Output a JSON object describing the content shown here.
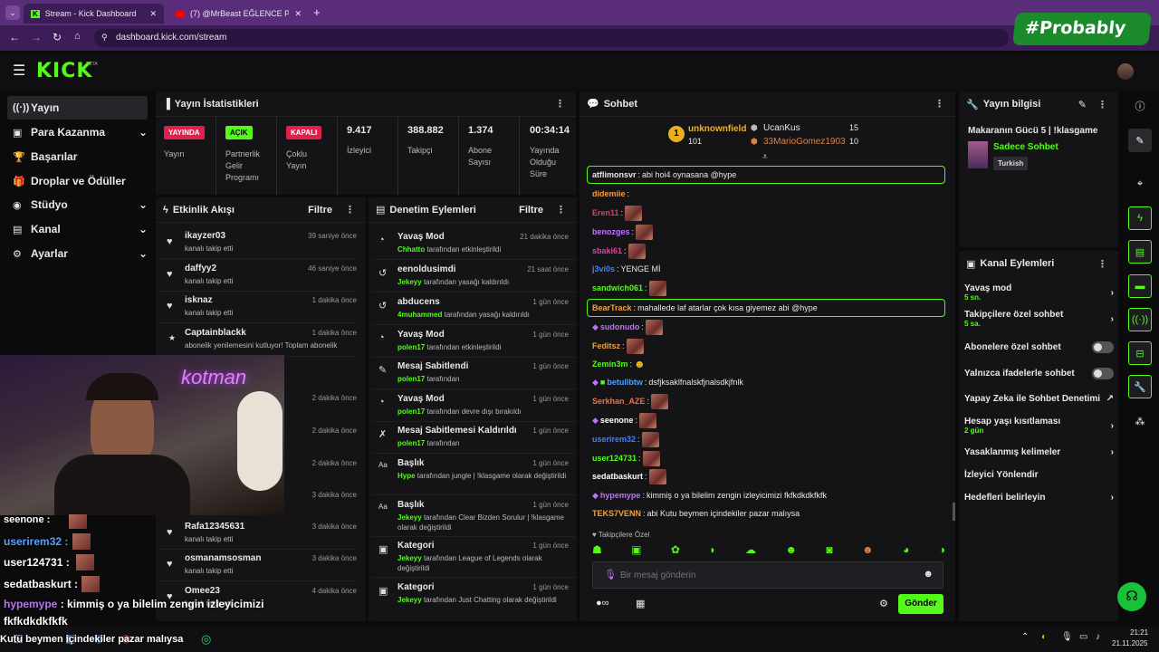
{
  "browser": {
    "tab1": "Stream - Kick Dashboard",
    "tab2": "(7) @MrBeast EĞLENCE PARKI...",
    "url": "dashboard.kick.com/stream"
  },
  "watermark": "#Probably",
  "app": {
    "logo": "KICK",
    "beta": "BETA"
  },
  "nav": [
    {
      "icon": "((·))",
      "label": "Yayın"
    },
    {
      "icon": "▣",
      "label": "Para Kazanma"
    },
    {
      "icon": "🏆",
      "label": "Başarılar"
    },
    {
      "icon": "🎁",
      "label": "Droplar ve Ödüller"
    },
    {
      "icon": "◉",
      "label": "Stüdyo"
    },
    {
      "icon": "▤",
      "label": "Kanal"
    },
    {
      "icon": "⚙",
      "label": "Ayarlar"
    }
  ],
  "stats": {
    "title": "Yayın İstatistikleri",
    "b1": "YAYINDA",
    "l1": "Yayın",
    "b2": "AÇIK",
    "l2a": "Partnerlik",
    "l2b": "Gelir",
    "l2c": "Programı",
    "b3": "KAPALI",
    "l3a": "Çoklu",
    "l3b": "Yayın",
    "v4": "9.417",
    "l4": "İzleyici",
    "v5": "388.882",
    "l5": "Takipçi",
    "v6": "1.374",
    "l6a": "Abone",
    "l6b": "Sayısı",
    "v7": "00:34:14",
    "l7a": "Yayında",
    "l7b": "Olduğu",
    "l7c": "Süre"
  },
  "activity": {
    "title": "Etkinlik Akışı",
    "filter": "Filtre",
    "items": [
      {
        "name": "ikayzer03",
        "sub": "kanalı takip etti",
        "time": "39 saniye önce"
      },
      {
        "name": "daffyy2",
        "sub": "kanalı takip etti",
        "time": "46 saniye önce"
      },
      {
        "name": "isknaz",
        "sub": "kanalı takip etti",
        "time": "1 dakika önce"
      },
      {
        "name": "Captainblackk",
        "sub": "abonelik yenilemesini kutluyor! Toplam abonelik",
        "time": "1 dakika önce"
      },
      {
        "name": "",
        "sub": "",
        "time": "2 dakika önce"
      },
      {
        "name": "",
        "sub": "",
        "time": "2 dakika önce"
      },
      {
        "name": "",
        "sub": "",
        "time": "2 dakika önce"
      },
      {
        "name": "",
        "sub": "",
        "time": "3 dakika önce"
      },
      {
        "name": "Rafa12345631",
        "sub": "kanalı takip etti",
        "time": "3 dakika önce"
      },
      {
        "name": "osmanamsosman",
        "sub": "kanalı takip etti",
        "time": "3 dakika önce"
      },
      {
        "name": "Omee23",
        "sub": "kanalı takip etti",
        "time": "4 dakika önce"
      }
    ]
  },
  "moderation": {
    "title": "Denetim Eylemleri",
    "filter": "Filtre",
    "items": [
      {
        "icon": "◔",
        "name": "Yavaş Mod",
        "who": "Chhatto",
        "rest": "tarafından etkinleştirildi",
        "time": "21 dakika önce"
      },
      {
        "icon": "↺",
        "name": "eenoldusimdi",
        "who": "Jekeyy",
        "rest": "tarafından yasağı kaldırıldı",
        "time": "21 saat önce"
      },
      {
        "icon": "↺",
        "name": "abducens",
        "who": "4muhammed",
        "rest": "tarafından yasağı kaldırıldı",
        "time": "1 gün önce"
      },
      {
        "icon": "◔",
        "name": "Yavaş Mod",
        "who": "polen17",
        "rest": "tarafından etkinleştirildi",
        "time": "1 gün önce"
      },
      {
        "icon": "✎",
        "name": "Mesaj Sabitlendi",
        "who": "polen17",
        "rest": "tarafından",
        "time": "1 gün önce"
      },
      {
        "icon": "◔",
        "name": "Yavaş Mod",
        "who": "polen17",
        "rest": "tarafından devre dışı bırakıldı",
        "time": "1 gün önce"
      },
      {
        "icon": "✗",
        "name": "Mesaj Sabitlemesi Kaldırıldı",
        "who": "polen17",
        "rest": "tarafından",
        "time": "1 gün önce"
      },
      {
        "icon": "Aa",
        "name": "Başlık",
        "who": "Hype",
        "rest": "tarafından jungle | !klasgame olarak değiştirildi",
        "time": "1 gün önce"
      },
      {
        "icon": "Aa",
        "name": "Başlık",
        "who": "Jekeyy",
        "rest": "tarafından Clear Bizden Sorulur | !klasgame olarak değiştirildi",
        "time": "1 gün önce"
      },
      {
        "icon": "▣",
        "name": "Kategori",
        "who": "Jekeyy",
        "rest": "tarafından League of Legends olarak değiştirildi",
        "time": "1 gün önce"
      },
      {
        "icon": "▣",
        "name": "Kategori",
        "who": "Jekeyy",
        "rest": "tarafından Just Chatting olarak değiştirildi",
        "time": "1 gün önce"
      }
    ]
  },
  "chat": {
    "title": "Sohbet",
    "top1": {
      "name": "unknownfield",
      "count": "101"
    },
    "top2": {
      "name": "UcanKus",
      "count": "15"
    },
    "top3": {
      "name": "33MarioGomez1903",
      "count": "10"
    },
    "messages": [
      {
        "user": "atflimonsvr",
        "color": "#fff",
        "text": "abi hoi4 oynasana @hype",
        "pinned": true
      },
      {
        "user": "didemiie",
        "color": "#f0a040",
        "text": ""
      },
      {
        "user": "Eren11",
        "color": "#e0405a",
        "text": ""
      },
      {
        "user": "benozges",
        "color": "#c070ff",
        "text": ""
      },
      {
        "user": "sbaki61",
        "color": "#e040a0",
        "text": ""
      },
      {
        "user": "j3vi0s",
        "color": "#4080ff",
        "text": "YENGE Mİ"
      },
      {
        "user": "sandwich061",
        "color": "#53fc18",
        "text": ""
      },
      {
        "user": "BearTrack",
        "color": "#f0a040",
        "text": "mahallede laf atarlar çok kısa giyemez abi @hype",
        "pinned": true
      },
      {
        "user": "sudonudo",
        "color": "#c070ff",
        "text": ""
      },
      {
        "user": "Feditsz",
        "color": "#f0a040",
        "text": ""
      },
      {
        "user": "Zemin3m",
        "color": "#53fc18",
        "text": ""
      },
      {
        "user": "betullbtw",
        "color": "#4aa0ff",
        "text": "dsfjksaklfnalskfjnalsdkjfnlk"
      },
      {
        "user": "Serkhan_AZE",
        "color": "#f07040",
        "text": ""
      },
      {
        "user": "seenone",
        "color": "#fff",
        "text": ""
      },
      {
        "user": "userirem32",
        "color": "#4080ff",
        "text": ""
      },
      {
        "user": "user124731",
        "color": "#53fc18",
        "text": ""
      },
      {
        "user": "sedatbaskurt",
        "color": "#fff",
        "text": ""
      },
      {
        "user": "hypemype",
        "color": "#c070ff",
        "text": "kimmiş o ya bilelim zengin izleyicimizi fkfkdkdkfkfk"
      },
      {
        "user": "TEKS7VENN",
        "color": "#f0a040",
        "text": "abi Kutu beymen içindekiler pazar malıysa"
      }
    ],
    "followers": "Takipçilere Özel",
    "placeholder": "Bir mesaj gönderin",
    "send": "Gönder"
  },
  "info": {
    "title": "Yayın bilgisi",
    "stream_title": "Makaranın Gücü 5 | !klasgame",
    "category": "Sadece Sohbet",
    "tag": "Turkish"
  },
  "actions": {
    "title": "Kanal Eylemleri",
    "items": [
      {
        "label": "Yavaş mod",
        "sub": "5 sn.",
        "ctl": "chev"
      },
      {
        "label": "Takipçilere özel sohbet",
        "sub": "5 sa.",
        "ctl": "chev"
      },
      {
        "label": "Abonelere özel sohbet",
        "sub": "",
        "ctl": "toggle"
      },
      {
        "label": "Yalnızca ifadelerle sohbet",
        "sub": "",
        "ctl": "toggle"
      },
      {
        "label": "Yapay Zeka ile Sohbet Denetimi",
        "sub": "",
        "ctl": "ext"
      },
      {
        "label": "Hesap yaşı kısıtlaması",
        "sub": "2 gün",
        "ctl": "chev"
      },
      {
        "label": "Yasaklanmış kelimeler",
        "sub": "",
        "ctl": "chev"
      },
      {
        "label": "İzleyici Yönlendir",
        "sub": "",
        "ctl": ""
      },
      {
        "label": "Hedefleri belirleyin",
        "sub": "",
        "ctl": "chev"
      }
    ]
  },
  "overlay": {
    "l1": "seenone :",
    "l2": "userirem32 :",
    "l3": "user124731 :",
    "l4": "sedatbaskurt :",
    "l5a": "hypemype",
    "l5b": ": kimmiş o ya bilelim zengin izleyicimizi",
    "l6": "fkfkdkdkfkfk",
    "l7": "Kutu beymen içindekiler pazar malıysa",
    "neon": "kotman"
  },
  "taskbar": {
    "time": "21:21",
    "date": "21.11.2025"
  }
}
